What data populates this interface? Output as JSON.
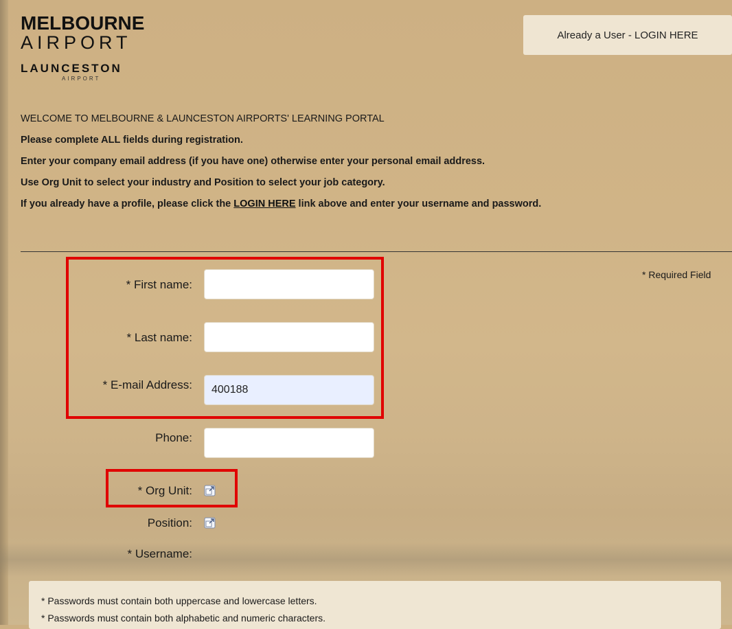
{
  "logo": {
    "line1": "MELBOURNE",
    "line2": "AIRPORT",
    "line3": "LAUNCESTON",
    "line4": "AIRPORT"
  },
  "header": {
    "login_button": "Already a User - LOGIN HERE"
  },
  "intro": {
    "title": "WELCOME TO MELBOURNE & LAUNCESTON AIRPORTS' LEARNING PORTAL",
    "line1": "Please complete ALL fields during registration.",
    "line2": "Enter your company email address (if you have one) otherwise enter your personal email address.",
    "line3": "Use Org Unit to select your industry and Position to select your job category.",
    "line4_before": "If you already have a profile, please click the ",
    "line4_link": "LOGIN HERE",
    "line4_after": " link above and enter your username and password."
  },
  "required_note": "* Required Field",
  "form": {
    "first_name_label": "* First name:",
    "first_name_value": "",
    "last_name_label": "* Last name:",
    "last_name_value": "",
    "email_label": "* E-mail Address:",
    "email_value": "400188",
    "phone_label": "Phone:",
    "phone_value": "",
    "org_unit_label": "* Org Unit:",
    "position_label": "Position:",
    "username_label": "* Username:"
  },
  "password_rules": [
    "* Passwords must contain both uppercase and lowercase letters.",
    "* Passwords must contain both alphabetic and numeric characters."
  ],
  "icons": {
    "picker": "external-picker-icon"
  },
  "colors": {
    "highlight": "#e00000",
    "background": "#d0b487"
  }
}
